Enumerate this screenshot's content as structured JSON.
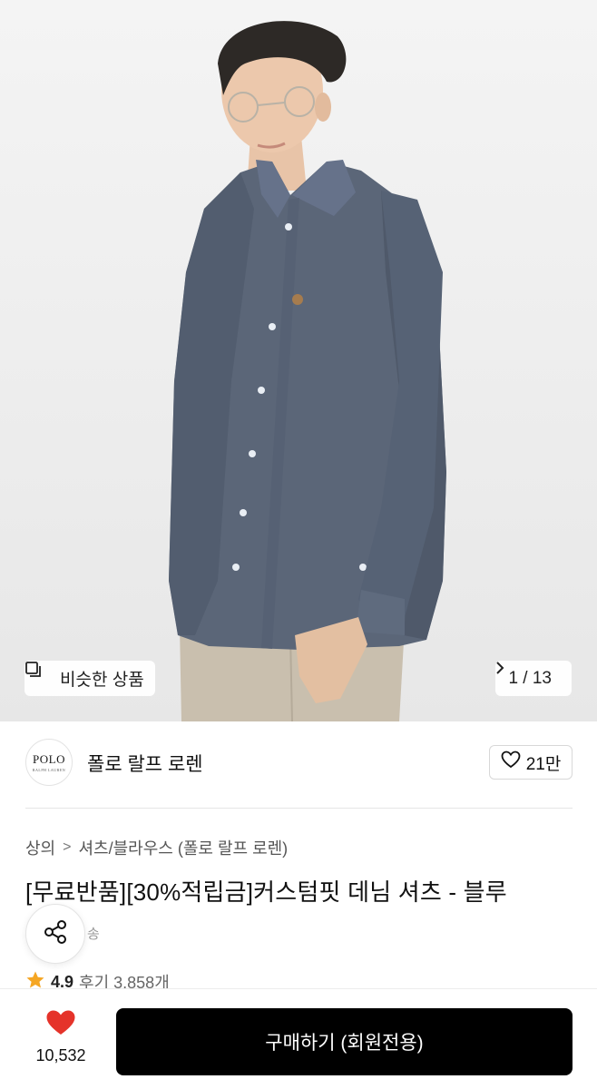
{
  "gallery": {
    "similar_label": "비슷한 상품",
    "pager": "1 / 13",
    "similar_icon": "overlap-squares-icon",
    "next_icon": "chevron-right-icon"
  },
  "brand": {
    "logo_text": "POLO",
    "logo_subtext": "RALPH LAUREN",
    "name": "폴로 랄프 로렌",
    "like_count": "21만",
    "like_icon": "heart-outline-icon"
  },
  "breadcrumb": {
    "items": [
      "상의",
      "셔츠/블라우스 (폴로 랄프 로렌)"
    ],
    "separator": ">"
  },
  "product": {
    "title": "[무료반품][30%적립금]커스텀핏 데님 셔츠 - 블루",
    "shipping_fragment": "송",
    "rating": "4.9",
    "reviews": "후기 3,858개"
  },
  "bottom_bar": {
    "fav_count": "10,532",
    "buy_label": "구매하기 (회원전용)",
    "fav_icon": "heart-filled-icon",
    "accent": "#e5332a"
  },
  "colors": {
    "button_bg": "#000000",
    "star": "#f5a623",
    "shirt": "#5a6677"
  }
}
